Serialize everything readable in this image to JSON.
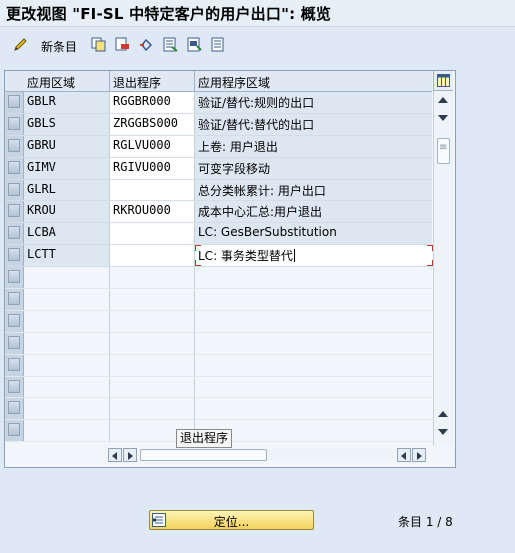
{
  "window": {
    "title": "更改视图 \"FI-SL 中特定客户的用户出口\": 概览"
  },
  "toolbar": {
    "new_entries_label": "新条目",
    "icons": [
      "edit-display-toggle-icon",
      "copy-icon",
      "delete-icon",
      "undo-icon",
      "select-all-icon",
      "select-block-icon",
      "deselect-all-icon"
    ]
  },
  "table": {
    "columns": [
      "应用区域",
      "退出程序",
      "应用程序区域"
    ],
    "rows": [
      {
        "area": "GBLR",
        "exit": "RGGBR000",
        "desc": "验证/替代:规则的出口"
      },
      {
        "area": "GBLS",
        "exit": "ZRGGBS000",
        "desc": "验证/替代:替代的出口"
      },
      {
        "area": "GBRU",
        "exit": "RGLVU000",
        "desc": "上卷: 用户退出"
      },
      {
        "area": "GIMV",
        "exit": "RGIVU000",
        "desc": "可变字段移动"
      },
      {
        "area": "GLRL",
        "exit": "",
        "desc": "总分类帐累计: 用户出口"
      },
      {
        "area": "KROU",
        "exit": "RKROU000",
        "desc": "成本中心汇总:用户退出"
      },
      {
        "area": "LCBA",
        "exit": "",
        "desc": "LC: GesBerSubstitution"
      },
      {
        "area": "LCTT",
        "exit": "",
        "desc": "LC: 事务类型替代"
      }
    ],
    "empty_rows": 8,
    "tooltip": "退出程序"
  },
  "footer": {
    "position_button_label": "定位...",
    "entry_count": "条目 1 / 8"
  },
  "colors": {
    "accent_yellow": "#f3d25a",
    "focus_red": "#c0392b",
    "row_blue": "#dde7f2"
  }
}
